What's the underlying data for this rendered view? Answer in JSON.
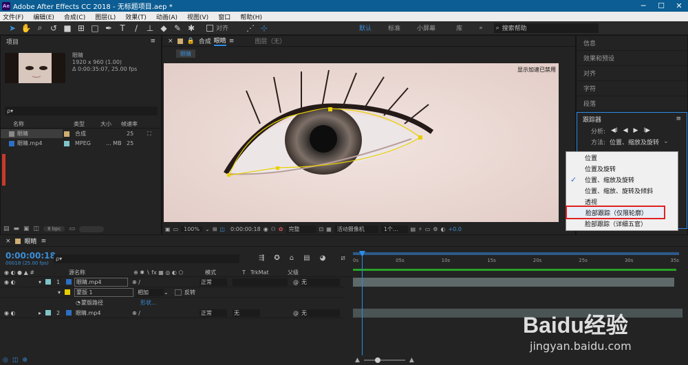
{
  "app": {
    "title": "Adobe After Effects CC 2018 - 无标题项目.aep *",
    "logo_text": "Ae",
    "minimize": "─",
    "maximize": "☐",
    "close": "✕"
  },
  "menu": [
    "文件(F)",
    "编辑(E)",
    "合成(C)",
    "图层(L)",
    "效果(T)",
    "动画(A)",
    "视图(V)",
    "窗口",
    "帮助(H)"
  ],
  "toolbar": {
    "snap_label": "对齐",
    "workspaces": [
      "默认",
      "标准",
      "小屏幕",
      "库"
    ],
    "search_placeholder": "搜索帮助"
  },
  "project": {
    "title": "项目",
    "comp_name": "眼睛",
    "comp_size": "1920 x 960 (1.00)",
    "comp_duration": "Δ 0:00:35:07, 25.00 fps",
    "search_placeholder": "ρ▾",
    "columns": [
      "名称",
      "类型",
      "大小",
      "帧速率"
    ],
    "items": [
      {
        "name": "眼睛",
        "type": "合成",
        "size": "",
        "fps": "25",
        "color": "#cfae72"
      },
      {
        "name": "眼睛.mp4",
        "type": "MPEG",
        "size": "... MB",
        "fps": "25",
        "color": "#7fc4c8"
      }
    ],
    "bpc": "8 bpc"
  },
  "composition": {
    "tab_label": "合成",
    "comp_name": "眼睛",
    "layer_label": "图层（无）",
    "sub_tab": "眼睛",
    "accel_notice": "显示加速已禁用",
    "zoom": "100%",
    "timecode": "0:00:00:18",
    "resolution": "完整",
    "camera": "活动摄像机",
    "views": "1个...",
    "exposure": "+0.0"
  },
  "right_panel": {
    "items": [
      "信息",
      "效果和预设",
      "对齐",
      "字符",
      "段落"
    ],
    "tracker_title": "跟踪器",
    "analyze_label": "分析:",
    "analyze_buttons": [
      "◀I",
      "◀",
      "▶",
      "I▶"
    ],
    "method_label": "方法:",
    "method_value": "位置、缩放及旋转"
  },
  "method_menu": {
    "items": [
      "位置",
      "位置及旋转",
      "位置、缩放及旋转",
      "位置、缩放、旋转及倾斜",
      "透视",
      "脸部跟踪（仅限轮廓）",
      "脸部跟踪（详细五官）"
    ],
    "checked_index": 2,
    "highlighted_index": 5,
    "check_mark": "✓"
  },
  "timeline": {
    "tab_label": "眼睛",
    "timecode": "0:00:00:18",
    "frame_info": "00018 (25.00 fps)",
    "search_placeholder": "ρ▾",
    "columns": {
      "source": "源名称",
      "mode": "模式",
      "t": "T",
      "trkmat": "TrkMat",
      "parent": "父级"
    },
    "ruler": [
      "0s",
      "05s",
      "10s",
      "15s",
      "20s",
      "25s",
      "30s",
      "35s"
    ],
    "layers": [
      {
        "index": "1",
        "name": "眼睛.mp4",
        "mode": "正常",
        "trkmat": "",
        "parent": "无"
      },
      {
        "index": "2",
        "name": "眼睛.mp4",
        "mode": "正常",
        "trkmat": "无",
        "parent": "无"
      }
    ],
    "mask": {
      "name": "蒙版 1",
      "mode": "相加",
      "invert": "反转",
      "path_label": "蒙版路径",
      "path_value": "形状..."
    }
  },
  "watermark": {
    "brand": "Baidu经验",
    "url": "jingyan.baidu.com"
  },
  "colors": {
    "accent": "#2d8ceb",
    "mask_yellow": "#e8d000",
    "highlight_red": "#e02020"
  }
}
